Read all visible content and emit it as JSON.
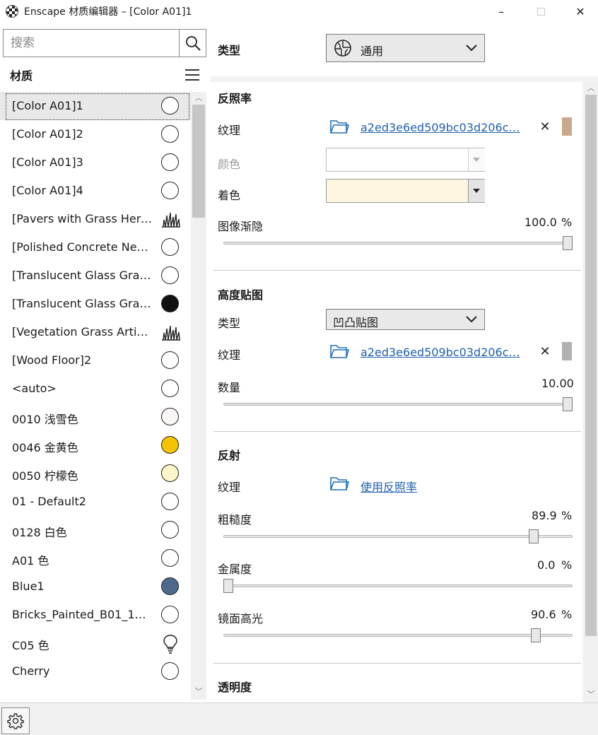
{
  "window": {
    "title": "Enscape 材质编辑器 – [Color A01]1",
    "minimize_glyph": "–",
    "close_glyph": "✕"
  },
  "sidebar": {
    "search_placeholder": "搜索",
    "header": "材质",
    "materials": [
      {
        "name": "[Color A01]1",
        "icon": "circle-icon",
        "fill": "#ffffff",
        "selected": true
      },
      {
        "name": "[Color A01]2",
        "icon": "circle-icon",
        "fill": "#ffffff"
      },
      {
        "name": "[Color A01]3",
        "icon": "circle-icon",
        "fill": "#ffffff"
      },
      {
        "name": "[Color A01]4",
        "icon": "circle-icon",
        "fill": "#ffffff"
      },
      {
        "name": "[Pavers with Grass Herr…",
        "icon": "grass-icon"
      },
      {
        "name": "[Polished Concrete Ne…",
        "icon": "circle-icon",
        "fill": "#ffffff"
      },
      {
        "name": "[Translucent Glass Gray…",
        "icon": "circle-icon",
        "fill": "#ffffff"
      },
      {
        "name": "[Translucent Glass Gray…",
        "icon": "circle-icon",
        "fill": "#111111"
      },
      {
        "name": "[Vegetation Grass Artifi…",
        "icon": "grass-icon"
      },
      {
        "name": "[Wood Floor]2",
        "icon": "circle-icon",
        "fill": "#ffffff"
      },
      {
        "name": "<auto>",
        "icon": "circle-icon",
        "fill": "#ffffff"
      },
      {
        "name": "0010 浅雪色",
        "icon": "circle-icon",
        "fill": "#fbf6f6"
      },
      {
        "name": "0046 金黄色",
        "icon": "circle-icon",
        "fill": "#f5c400"
      },
      {
        "name": "0050 柠檬色",
        "icon": "circle-icon",
        "fill": "#fdf6c8"
      },
      {
        "name": "01 - Default2",
        "icon": "circle-icon",
        "fill": "#ffffff"
      },
      {
        "name": "0128 白色",
        "icon": "circle-icon",
        "fill": "#ffffff"
      },
      {
        "name": "A01 色",
        "icon": "circle-icon",
        "fill": "#ffffff"
      },
      {
        "name": "Blue1",
        "icon": "circle-icon",
        "fill": "#4d6a8c"
      },
      {
        "name": "Bricks_Painted_B01_1…",
        "icon": "circle-icon",
        "fill": "#ffffff"
      },
      {
        "name": "C05 色",
        "icon": "bulb-icon"
      },
      {
        "name": "Cherry",
        "icon": "circle-icon",
        "fill": "#ffffff"
      }
    ]
  },
  "type_row": {
    "label": "类型",
    "value": "通用"
  },
  "albedo": {
    "title": "反照率",
    "texture_label": "纹理",
    "texture_file": "a2ed3e6ed509bc03d206c…",
    "texture_swatch": "#c9a98b",
    "color_label": "颜色",
    "tint_label": "着色",
    "tint_color": "#fdf5e0",
    "fade_label": "图像渐隐",
    "fade_value": "100.0",
    "fade_unit": "%",
    "fade_fraction": 1.0
  },
  "height_map": {
    "title": "高度贴图",
    "type_label": "类型",
    "type_value": "凹凸贴图",
    "texture_label": "纹理",
    "texture_file": "a2ed3e6ed509bc03d206c…",
    "texture_swatch": "#b0b0b0",
    "amount_label": "数量",
    "amount_value": "10.00",
    "amount_fraction": 1.0
  },
  "reflection": {
    "title": "反射",
    "texture_label": "纹理",
    "texture_link": "使用反照率",
    "roughness_label": "粗糙度",
    "roughness_value": "89.9",
    "roughness_fraction": 0.899,
    "metallic_label": "金属度",
    "metallic_value": "0.0",
    "metallic_fraction": 0.0,
    "specular_label": "镜面高光",
    "specular_value": "90.6",
    "specular_fraction": 0.906,
    "unit": "%"
  },
  "transparency": {
    "title": "透明度"
  }
}
